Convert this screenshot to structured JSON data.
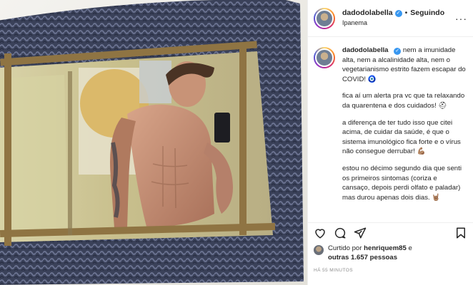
{
  "post": {
    "username": "dadodolabella",
    "follow_state": "Seguindo",
    "location": "Ipanema",
    "more_icon": "more-horizontal-icon",
    "verified_icon": "verified-badge-icon",
    "photo_subject": "mirror selfie photo"
  },
  "caption": {
    "username": "dadodolabella",
    "paragraphs": [
      "nem a imunidade alta, nem a alcalinidade alta, nem o vegetarianismo estrito fazem escapar do COVID! 🧿",
      "fica aí um alerta pra vc que ta relaxando da quarentena e dos cuidados! ⛑",
      "a diferença de ter tudo isso que citei acima, de cuidar da saúde, é que o sistema imunológico fica forte e o vírus não consegue derrubar! 💪🏽",
      "estou no décimo segundo dia que senti os primeiros sintomas (coriza e cansaço, depois perdi olfato e paladar) mas durou apenas dois dias. 🤘🏽"
    ]
  },
  "actions": {
    "like_icon": "heart-icon",
    "comment_icon": "comment-icon",
    "share_icon": "share-icon",
    "save_icon": "bookmark-icon"
  },
  "likes": {
    "prefix": "Curtido por ",
    "user": "henriquem85",
    "middle": " e",
    "others": "outras 1.657 pessoas"
  },
  "timestamp": "HÁ 55 MINUTOS",
  "colors": {
    "verified": "#3897f0",
    "text": "#262626",
    "muted": "#8e8e8e",
    "wicker": "#39405a"
  }
}
